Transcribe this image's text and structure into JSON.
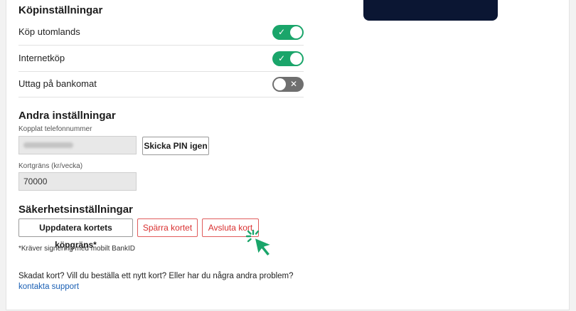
{
  "purchase_settings": {
    "title": "Köpinställningar",
    "rows": [
      {
        "label": "Köp utomlands",
        "state": "on",
        "mark": "✓"
      },
      {
        "label": "Internetköp",
        "state": "on",
        "mark": "✓"
      },
      {
        "label": "Uttag på bankomat",
        "state": "off",
        "mark": "✕"
      }
    ]
  },
  "other_settings": {
    "title": "Andra inställningar",
    "phone_label": "Kopplat telefonnummer",
    "resend_pin_label": "Skicka PIN igen",
    "limit_label": "Kortgräns (kr/vecka)",
    "limit_value": "70000"
  },
  "security_settings": {
    "title": "Säkerhetsinställningar",
    "update_limit_label": "Uppdatera kortets köpgräns*",
    "block_card_label": "Spärra kortet",
    "close_card_label": "Avsluta kort",
    "note": "*Kräver signering med mobilt BankID"
  },
  "footer": {
    "text": "Skadat kort? Vill du beställa ett nytt kort? Eller har du några andra problem?",
    "link_text": "kontakta support"
  },
  "colors": {
    "toggle_on": "#1aa56a",
    "toggle_off": "#6f6f6f",
    "danger": "#d93030",
    "link": "#1a5fb4",
    "cursor": "#1aa56a"
  }
}
